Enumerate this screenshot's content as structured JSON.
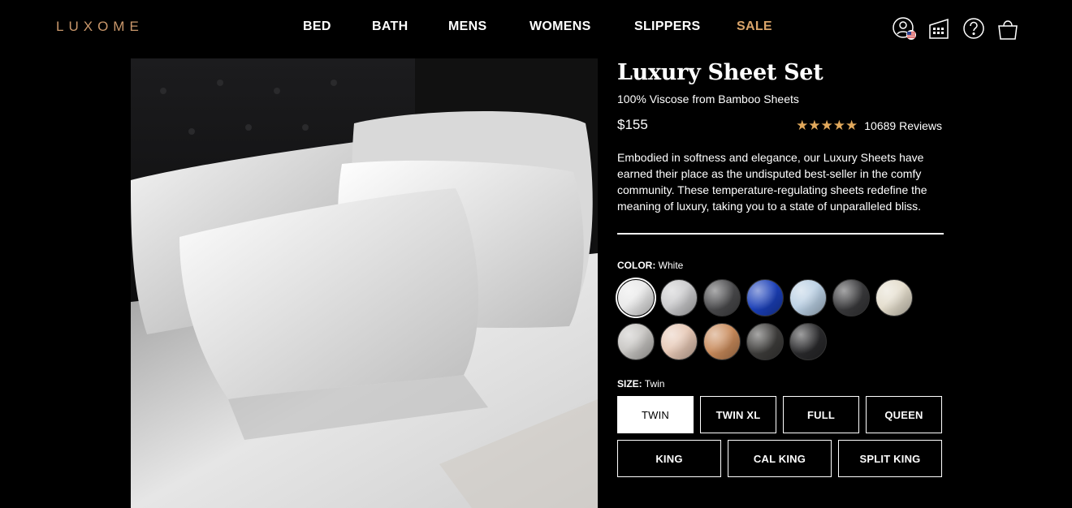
{
  "brand": {
    "logo": "LUXOME"
  },
  "nav": {
    "items": [
      "BED",
      "BATH",
      "MENS",
      "WOMENS",
      "SLIPPERS",
      "SALE"
    ],
    "sale_color": "#d9a46a"
  },
  "header_icons": [
    "account-us-flag-icon",
    "store-locator-icon",
    "help-icon",
    "shopping-bag-icon"
  ],
  "product": {
    "title": "Luxury Sheet Set",
    "subtitle": "100% Viscose from Bamboo Sheets",
    "price": "$155",
    "rating": 5,
    "rating_stars": "★★★★★",
    "reviews": "10689 Reviews",
    "description": "Embodied in softness and elegance, our Luxury Sheets have earned their place as the undisputed best-seller in the comfy community. These temperature-regulating sheets redefine the meaning of luxury, taking you to a state of unparalleled bliss.",
    "star_color": "#e2a95c"
  },
  "color": {
    "label": "COLOR:",
    "selected": "White",
    "swatches": [
      {
        "color": "#e8e8e8",
        "selected": true
      },
      {
        "color": "#c9c9cb"
      },
      {
        "color": "#4a4a4c"
      },
      {
        "color": "#1a3fb8"
      },
      {
        "color": "#b9cfe3"
      },
      {
        "color": "#3a3a3c"
      },
      {
        "color": "#e3dccb"
      },
      {
        "color": "#c5c3c0"
      },
      {
        "color": "#e6c7b4"
      },
      {
        "color": "#c98a5a"
      },
      {
        "color": "#3e3d3b"
      },
      {
        "color": "#2a2a2c"
      }
    ]
  },
  "size": {
    "label": "SIZE:",
    "selected": "Twin",
    "options": [
      "TWIN",
      "TWIN XL",
      "FULL",
      "QUEEN",
      "KING",
      "CAL KING",
      "SPLIT KING"
    ]
  }
}
